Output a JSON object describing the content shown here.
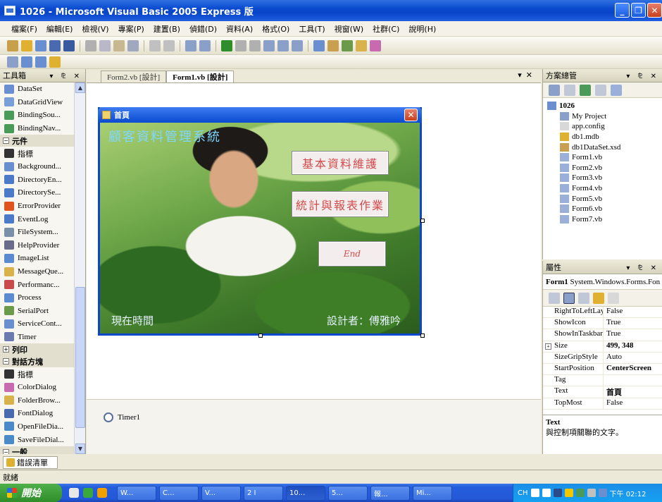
{
  "window": {
    "title": "1026 - Microsoft Visual Basic 2005 Express 版"
  },
  "menu": [
    "檔案(F)",
    "編輯(E)",
    "檢視(V)",
    "專案(P)",
    "建置(B)",
    "偵錯(D)",
    "資料(A)",
    "格式(O)",
    "工具(T)",
    "視窗(W)",
    "社群(C)",
    "說明(H)"
  ],
  "toolbox": {
    "title": "工具箱",
    "items": [
      {
        "type": "item",
        "label": "DataSet",
        "icon": "dataset-icon",
        "color": "#6a8fd0"
      },
      {
        "type": "item",
        "label": "DataGridView",
        "icon": "datagridview-icon",
        "color": "#7a9ed8"
      },
      {
        "type": "item",
        "label": "BindingSou...",
        "icon": "bindingsource-icon",
        "color": "#4a9a5a"
      },
      {
        "type": "item",
        "label": "BindingNav...",
        "icon": "bindingnavigator-icon",
        "color": "#4a9a5a"
      },
      {
        "type": "group",
        "label": "元件",
        "expander": "−"
      },
      {
        "type": "item",
        "label": "指標",
        "icon": "pointer-icon",
        "color": "#333333"
      },
      {
        "type": "item",
        "label": "Background...",
        "icon": "backgroundworker-icon",
        "color": "#6a8fd0"
      },
      {
        "type": "item",
        "label": "DirectoryEn...",
        "icon": "directoryentry-icon",
        "color": "#4a7ac8"
      },
      {
        "type": "item",
        "label": "DirectorySe...",
        "icon": "directorysearcher-icon",
        "color": "#4a7ac8"
      },
      {
        "type": "item",
        "label": "ErrorProvider",
        "icon": "errorprovider-icon",
        "color": "#e0521e"
      },
      {
        "type": "item",
        "label": "EventLog",
        "icon": "eventlog-icon",
        "color": "#4a7ac8"
      },
      {
        "type": "item",
        "label": "FileSystem...",
        "icon": "filesystemwatcher-icon",
        "color": "#7a8fa8"
      },
      {
        "type": "item",
        "label": "HelpProvider",
        "icon": "helpprovider-icon",
        "color": "#6a6a8a"
      },
      {
        "type": "item",
        "label": "ImageList",
        "icon": "imagelist-icon",
        "color": "#5a8ad0"
      },
      {
        "type": "item",
        "label": "MessageQue...",
        "icon": "messagequeue-icon",
        "color": "#d8b24a"
      },
      {
        "type": "item",
        "label": "Performanc...",
        "icon": "performancecounter-icon",
        "color": "#c84a4a"
      },
      {
        "type": "item",
        "label": "Process",
        "icon": "process-icon",
        "color": "#5a8ad0"
      },
      {
        "type": "item",
        "label": "SerialPort",
        "icon": "serialport-icon",
        "color": "#6a9a4a"
      },
      {
        "type": "item",
        "label": "ServiceCont...",
        "icon": "servicecontroller-icon",
        "color": "#6a8fd0"
      },
      {
        "type": "item",
        "label": "Timer",
        "icon": "timer-icon",
        "color": "#6a7ab0"
      },
      {
        "type": "group",
        "label": "列印",
        "expander": "+"
      },
      {
        "type": "group",
        "label": "對話方塊",
        "expander": "−"
      },
      {
        "type": "item",
        "label": "指標",
        "icon": "pointer-icon",
        "color": "#333333"
      },
      {
        "type": "item",
        "label": "ColorDialog",
        "icon": "colordialog-icon",
        "color": "#c86ab0"
      },
      {
        "type": "item",
        "label": "FolderBrow...",
        "icon": "folderbrowserdialog-icon",
        "color": "#d8b24a"
      },
      {
        "type": "item",
        "label": "FontDialog",
        "icon": "fontdialog-icon",
        "color": "#4a6ab0"
      },
      {
        "type": "item",
        "label": "OpenFileDia...",
        "icon": "openfiledialog-icon",
        "color": "#4a8ac8"
      },
      {
        "type": "item",
        "label": "SaveFileDial...",
        "icon": "savefiledialog-icon",
        "color": "#4a8ac8"
      },
      {
        "type": "group",
        "label": "一般",
        "expander": "−"
      }
    ]
  },
  "doc_tabs": [
    "Form2.vb [設計]",
    "Form1.vb [設計]"
  ],
  "form": {
    "caption": "首頁",
    "app_title": "顧客資料管理系統",
    "btn_basic": "基本資料維護",
    "btn_report": "統計與報表作業",
    "btn_end": "End",
    "label_time": "現在時間",
    "label_designer": "設計者：傅雅吟"
  },
  "tray": {
    "component": "Timer1"
  },
  "solution_explorer": {
    "title": "方案總管",
    "root": "1026",
    "items": [
      {
        "label": "My Project",
        "icon": "my-project-icon",
        "color": "#8aa0c8"
      },
      {
        "label": "app.config",
        "icon": "config-file-icon",
        "color": "#d8d8d8"
      },
      {
        "label": "db1.mdb",
        "icon": "database-icon",
        "color": "#e0b030"
      },
      {
        "label": "db1DataSet.xsd",
        "icon": "dataset-file-icon",
        "color": "#c8a050"
      },
      {
        "label": "Form1.vb",
        "icon": "form-file-icon",
        "color": "#9ab0d8"
      },
      {
        "label": "Form2.vb",
        "icon": "form-file-icon",
        "color": "#9ab0d8"
      },
      {
        "label": "Form3.vb",
        "icon": "form-file-icon",
        "color": "#9ab0d8"
      },
      {
        "label": "Form4.vb",
        "icon": "form-file-icon",
        "color": "#9ab0d8"
      },
      {
        "label": "Form5.vb",
        "icon": "form-file-icon",
        "color": "#9ab0d8"
      },
      {
        "label": "Form6.vb",
        "icon": "form-file-icon",
        "color": "#9ab0d8"
      },
      {
        "label": "Form7.vb",
        "icon": "form-file-icon",
        "color": "#9ab0d8"
      }
    ]
  },
  "properties": {
    "title": "屬性",
    "object_name": "Form1",
    "object_type": "System.Windows.Forms.Fon",
    "rows": [
      {
        "name": "RightToLeftLay",
        "value": "False",
        "bold": false
      },
      {
        "name": "ShowIcon",
        "value": "True",
        "bold": false
      },
      {
        "name": "ShowInTaskbar",
        "value": "True",
        "bold": false
      },
      {
        "name": "Size",
        "value": "499, 348",
        "bold": true,
        "expander": "+"
      },
      {
        "name": "SizeGripStyle",
        "value": "Auto",
        "bold": false
      },
      {
        "name": "StartPosition",
        "value": "CenterScreen",
        "bold": true
      },
      {
        "name": "Tag",
        "value": "",
        "bold": false
      },
      {
        "name": "Text",
        "value": "首頁",
        "bold": true
      },
      {
        "name": "TopMost",
        "value": "False",
        "bold": false
      }
    ],
    "desc_title": "Text",
    "desc_text": "與控制項關聯的文字。"
  },
  "bottom": {
    "error_tab": "錯誤清單",
    "status": "就緒"
  },
  "taskbar": {
    "start": "開始",
    "tasks": [
      "W...",
      "C...",
      "V...",
      "2 I",
      "10...",
      "5...",
      "報...",
      "Mi..."
    ],
    "tray_lang": "CH",
    "clock": "下午 02:12"
  }
}
